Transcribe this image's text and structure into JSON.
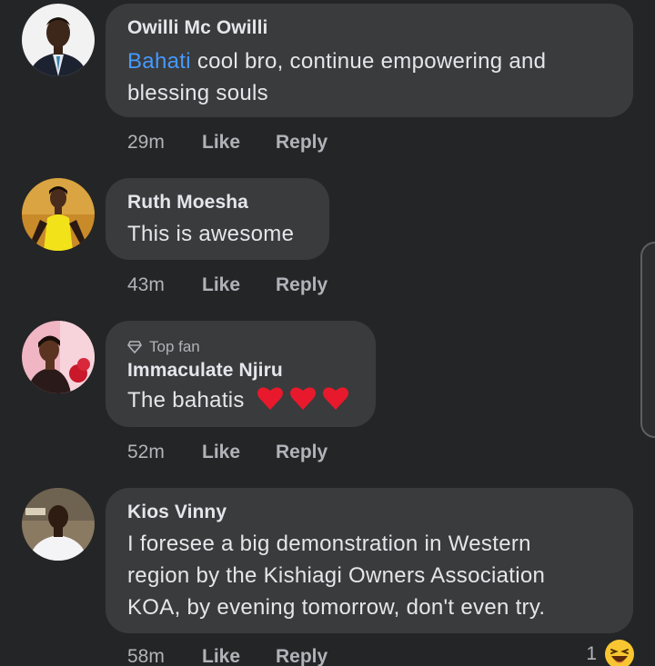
{
  "comments": [
    {
      "author": "Owilli Mc Owilli",
      "mention": "Bahati",
      "text_line1": " cool bro, continue empowering and",
      "text_line2": "blessing souls",
      "time": "29m",
      "like_label": "Like",
      "reply_label": "Reply"
    },
    {
      "author": "Ruth Moesha",
      "text": "This is awesome",
      "time": "43m",
      "like_label": "Like",
      "reply_label": "Reply"
    },
    {
      "badge": "Top fan",
      "author": "Immaculate Njiru",
      "text": "The bahatis",
      "time": "52m",
      "like_label": "Like",
      "reply_label": "Reply"
    },
    {
      "author": "Kios Vinny",
      "text_line1": "I foresee a big demonstration in Western",
      "text_line2": "region by the Kishiagi Owners Association",
      "text_line3": "KOA, by evening tomorrow,  don't even try.",
      "time": "58m",
      "like_label": "Like",
      "reply_label": "Reply",
      "reaction_count": "1"
    }
  ],
  "icons": {
    "heart": "heart-emoji",
    "reaction": "laughing-emoji",
    "badge": "diamond-icon"
  },
  "colors": {
    "background": "#242526",
    "bubble": "#3a3b3c",
    "mention": "#4599ff",
    "heart": "#e8192c"
  }
}
